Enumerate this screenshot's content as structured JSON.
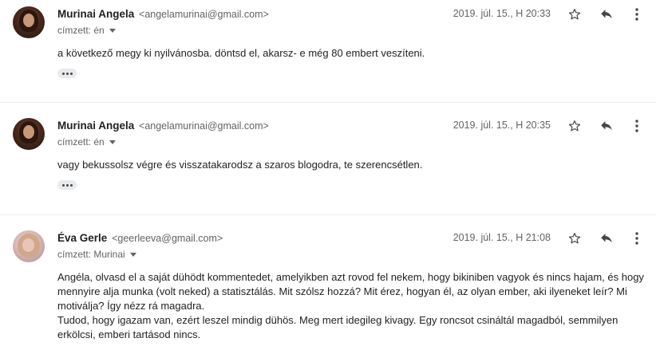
{
  "messages": [
    {
      "sender_name": "Murinai Angela",
      "sender_email": "<angelamurinai@gmail.com>",
      "recipient": "címzett: én",
      "date": "2019. júl. 15., H 20:33",
      "body": [
        "a következő megy ki nyilvánosba. döntsd el, akarsz- e még 80 embert veszíteni."
      ],
      "has_trimmed": true
    },
    {
      "sender_name": "Murinai Angela",
      "sender_email": "<angelamurinai@gmail.com>",
      "recipient": "címzett: én",
      "date": "2019. júl. 15., H 20:35",
      "body": [
        "vagy bekussolsz végre és visszatakarodsz a szaros blogodra, te szerencsétlen."
      ],
      "has_trimmed": true
    },
    {
      "sender_name": "Éva Gerle",
      "sender_email": "<geerleeva@gmail.com>",
      "recipient": "címzett: Murinai",
      "date": "2019. júl. 15., H 21:08",
      "body": [
        "Angéla, olvasd el a saját dühödt kommentedet, amelyikben azt rovod fel nekem, hogy bikiniben vagyok és nincs hajam, és hogy mennyire alja munka (volt neked) a statisztálás. Mit szólsz hozzá? Mit érez, hogyan él, az olyan ember, aki ilyeneket leír? Mi motiválja? Így nézz rá magadra.",
        "Tudod, hogy igazam van, ezért leszel mindig dühös. Meg mert idegileg kivagy. Egy roncsot csináltál magadból, semmilyen erkölcsi, emberi tartásod nincs."
      ],
      "has_trimmed": false
    }
  ],
  "icons": {
    "star": "star-icon",
    "reply": "reply-icon",
    "more": "more-vert-icon",
    "expand": "chevron-down-icon"
  },
  "colors": {
    "icon": "#444746",
    "secondary_text": "#5f6368",
    "divider": "#eceff1"
  }
}
